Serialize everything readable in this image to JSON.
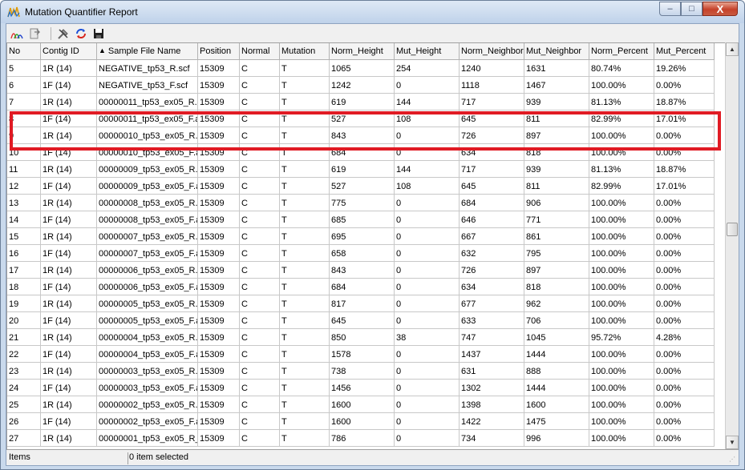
{
  "window": {
    "title": "Mutation Quantifier Report",
    "buttons": {
      "minimize": "–",
      "maximize": "□",
      "close": "X"
    }
  },
  "toolbar": {
    "icons": [
      "chromatogram-icon",
      "export-icon",
      "tools-icon",
      "refresh-icon",
      "save-icon"
    ]
  },
  "table": {
    "columns": [
      "No",
      "Contig ID",
      "Sample File Name",
      "Position",
      "Normal",
      "Mutation",
      "Norm_Height",
      "Mut_Height",
      "Norm_Neighbor",
      "Mut_Neighbor",
      "Norm_Percent",
      "Mut_Percent"
    ],
    "sorted_column": "Sample File Name",
    "rows": [
      [
        "5",
        "1R (14)",
        "NEGATIVE_tp53_R.scf",
        "15309",
        "C",
        "T",
        "1065",
        "254",
        "1240",
        "1631",
        "80.74%",
        "19.26%"
      ],
      [
        "6",
        "1F (14)",
        "NEGATIVE_tp53_F.scf",
        "15309",
        "C",
        "T",
        "1242",
        "0",
        "1118",
        "1467",
        "100.00%",
        "0.00%"
      ],
      [
        "7",
        "1R (14)",
        "00000011_tp53_ex05_R.",
        "15309",
        "C",
        "T",
        "619",
        "144",
        "717",
        "939",
        "81.13%",
        "18.87%"
      ],
      [
        "8",
        "1F (14)",
        "00000011_tp53_ex05_F.a",
        "15309",
        "C",
        "T",
        "527",
        "108",
        "645",
        "811",
        "82.99%",
        "17.01%"
      ],
      [
        "9",
        "1R (14)",
        "00000010_tp53_ex05_R.",
        "15309",
        "C",
        "T",
        "843",
        "0",
        "726",
        "897",
        "100.00%",
        "0.00%"
      ],
      [
        "10",
        "1F (14)",
        "00000010_tp53_ex05_F.a",
        "15309",
        "C",
        "T",
        "684",
        "0",
        "634",
        "818",
        "100.00%",
        "0.00%"
      ],
      [
        "11",
        "1R (14)",
        "00000009_tp53_ex05_R.",
        "15309",
        "C",
        "T",
        "619",
        "144",
        "717",
        "939",
        "81.13%",
        "18.87%"
      ],
      [
        "12",
        "1F (14)",
        "00000009_tp53_ex05_F.a",
        "15309",
        "C",
        "T",
        "527",
        "108",
        "645",
        "811",
        "82.99%",
        "17.01%"
      ],
      [
        "13",
        "1R (14)",
        "00000008_tp53_ex05_R.",
        "15309",
        "C",
        "T",
        "775",
        "0",
        "684",
        "906",
        "100.00%",
        "0.00%"
      ],
      [
        "14",
        "1F (14)",
        "00000008_tp53_ex05_F.a",
        "15309",
        "C",
        "T",
        "685",
        "0",
        "646",
        "771",
        "100.00%",
        "0.00%"
      ],
      [
        "15",
        "1R (14)",
        "00000007_tp53_ex05_R.",
        "15309",
        "C",
        "T",
        "695",
        "0",
        "667",
        "861",
        "100.00%",
        "0.00%"
      ],
      [
        "16",
        "1F (14)",
        "00000007_tp53_ex05_F.a",
        "15309",
        "C",
        "T",
        "658",
        "0",
        "632",
        "795",
        "100.00%",
        "0.00%"
      ],
      [
        "17",
        "1R (14)",
        "00000006_tp53_ex05_R.",
        "15309",
        "C",
        "T",
        "843",
        "0",
        "726",
        "897",
        "100.00%",
        "0.00%"
      ],
      [
        "18",
        "1F (14)",
        "00000006_tp53_ex05_F.a",
        "15309",
        "C",
        "T",
        "684",
        "0",
        "634",
        "818",
        "100.00%",
        "0.00%"
      ],
      [
        "19",
        "1R (14)",
        "00000005_tp53_ex05_R.",
        "15309",
        "C",
        "T",
        "817",
        "0",
        "677",
        "962",
        "100.00%",
        "0.00%"
      ],
      [
        "20",
        "1F (14)",
        "00000005_tp53_ex05_F.a",
        "15309",
        "C",
        "T",
        "645",
        "0",
        "633",
        "706",
        "100.00%",
        "0.00%"
      ],
      [
        "21",
        "1R (14)",
        "00000004_tp53_ex05_R.",
        "15309",
        "C",
        "T",
        "850",
        "38",
        "747",
        "1045",
        "95.72%",
        "4.28%"
      ],
      [
        "22",
        "1F (14)",
        "00000004_tp53_ex05_F.a",
        "15309",
        "C",
        "T",
        "1578",
        "0",
        "1437",
        "1444",
        "100.00%",
        "0.00%"
      ],
      [
        "23",
        "1R (14)",
        "00000003_tp53_ex05_R.",
        "15309",
        "C",
        "T",
        "738",
        "0",
        "631",
        "888",
        "100.00%",
        "0.00%"
      ],
      [
        "24",
        "1F (14)",
        "00000003_tp53_ex05_F.a",
        "15309",
        "C",
        "T",
        "1456",
        "0",
        "1302",
        "1444",
        "100.00%",
        "0.00%"
      ],
      [
        "25",
        "1R (14)",
        "00000002_tp53_ex05_R.",
        "15309",
        "C",
        "T",
        "1600",
        "0",
        "1398",
        "1600",
        "100.00%",
        "0.00%"
      ],
      [
        "26",
        "1F (14)",
        "00000002_tp53_ex05_F.a",
        "15309",
        "C",
        "T",
        "1600",
        "0",
        "1422",
        "1475",
        "100.00%",
        "0.00%"
      ],
      [
        "27",
        "1R (14)",
        "00000001_tp53_ex05_R_",
        "15309",
        "C",
        "T",
        "786",
        "0",
        "734",
        "996",
        "100.00%",
        "0.00%"
      ]
    ],
    "highlighted_rows": [
      "7",
      "8"
    ],
    "highlight_color": "#e01b24"
  },
  "statusbar": {
    "items_label": "Items",
    "selection_text": "0 item selected"
  }
}
